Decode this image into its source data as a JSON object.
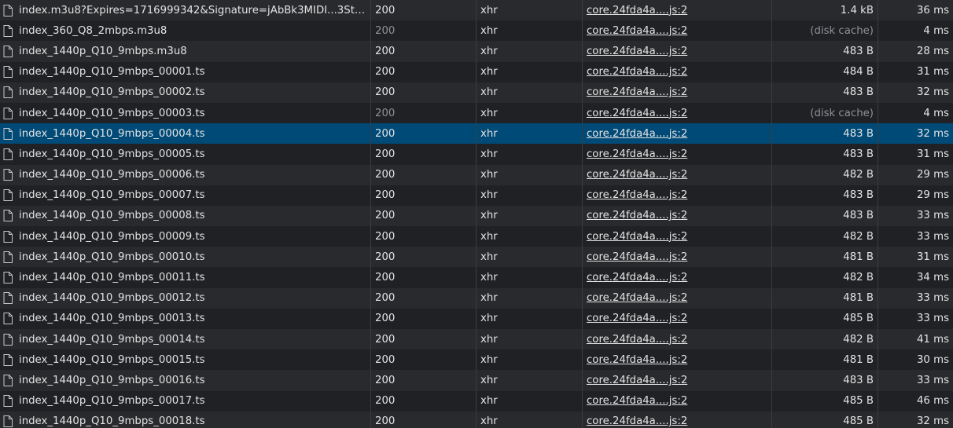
{
  "requests": [
    {
      "name": "index.m3u8?Expires=1716999342&Signature=jAbBk3MIDI...3StG...",
      "status": "200",
      "type": "xhr",
      "initiator": "core.24fda4a....js:2",
      "size": "1.4 kB",
      "time": "36 ms",
      "cached": false,
      "selected": false
    },
    {
      "name": "index_360_Q8_2mbps.m3u8",
      "status": "200",
      "type": "xhr",
      "initiator": "core.24fda4a....js:2",
      "size": "(disk cache)",
      "time": "4 ms",
      "cached": true,
      "selected": false
    },
    {
      "name": "index_1440p_Q10_9mbps.m3u8",
      "status": "200",
      "type": "xhr",
      "initiator": "core.24fda4a....js:2",
      "size": "483 B",
      "time": "28 ms",
      "cached": false,
      "selected": false
    },
    {
      "name": "index_1440p_Q10_9mbps_00001.ts",
      "status": "200",
      "type": "xhr",
      "initiator": "core.24fda4a....js:2",
      "size": "484 B",
      "time": "31 ms",
      "cached": false,
      "selected": false
    },
    {
      "name": "index_1440p_Q10_9mbps_00002.ts",
      "status": "200",
      "type": "xhr",
      "initiator": "core.24fda4a....js:2",
      "size": "483 B",
      "time": "32 ms",
      "cached": false,
      "selected": false
    },
    {
      "name": "index_1440p_Q10_9mbps_00003.ts",
      "status": "200",
      "type": "xhr",
      "initiator": "core.24fda4a....js:2",
      "size": "(disk cache)",
      "time": "4 ms",
      "cached": true,
      "selected": false
    },
    {
      "name": "index_1440p_Q10_9mbps_00004.ts",
      "status": "200",
      "type": "xhr",
      "initiator": "core.24fda4a....js:2",
      "size": "483 B",
      "time": "32 ms",
      "cached": false,
      "selected": true
    },
    {
      "name": "index_1440p_Q10_9mbps_00005.ts",
      "status": "200",
      "type": "xhr",
      "initiator": "core.24fda4a....js:2",
      "size": "483 B",
      "time": "31 ms",
      "cached": false,
      "selected": false
    },
    {
      "name": "index_1440p_Q10_9mbps_00006.ts",
      "status": "200",
      "type": "xhr",
      "initiator": "core.24fda4a....js:2",
      "size": "482 B",
      "time": "29 ms",
      "cached": false,
      "selected": false
    },
    {
      "name": "index_1440p_Q10_9mbps_00007.ts",
      "status": "200",
      "type": "xhr",
      "initiator": "core.24fda4a....js:2",
      "size": "483 B",
      "time": "29 ms",
      "cached": false,
      "selected": false
    },
    {
      "name": "index_1440p_Q10_9mbps_00008.ts",
      "status": "200",
      "type": "xhr",
      "initiator": "core.24fda4a....js:2",
      "size": "483 B",
      "time": "33 ms",
      "cached": false,
      "selected": false
    },
    {
      "name": "index_1440p_Q10_9mbps_00009.ts",
      "status": "200",
      "type": "xhr",
      "initiator": "core.24fda4a....js:2",
      "size": "482 B",
      "time": "33 ms",
      "cached": false,
      "selected": false
    },
    {
      "name": "index_1440p_Q10_9mbps_00010.ts",
      "status": "200",
      "type": "xhr",
      "initiator": "core.24fda4a....js:2",
      "size": "481 B",
      "time": "31 ms",
      "cached": false,
      "selected": false
    },
    {
      "name": "index_1440p_Q10_9mbps_00011.ts",
      "status": "200",
      "type": "xhr",
      "initiator": "core.24fda4a....js:2",
      "size": "482 B",
      "time": "34 ms",
      "cached": false,
      "selected": false
    },
    {
      "name": "index_1440p_Q10_9mbps_00012.ts",
      "status": "200",
      "type": "xhr",
      "initiator": "core.24fda4a....js:2",
      "size": "481 B",
      "time": "33 ms",
      "cached": false,
      "selected": false
    },
    {
      "name": "index_1440p_Q10_9mbps_00013.ts",
      "status": "200",
      "type": "xhr",
      "initiator": "core.24fda4a....js:2",
      "size": "485 B",
      "time": "33 ms",
      "cached": false,
      "selected": false
    },
    {
      "name": "index_1440p_Q10_9mbps_00014.ts",
      "status": "200",
      "type": "xhr",
      "initiator": "core.24fda4a....js:2",
      "size": "482 B",
      "time": "41 ms",
      "cached": false,
      "selected": false
    },
    {
      "name": "index_1440p_Q10_9mbps_00015.ts",
      "status": "200",
      "type": "xhr",
      "initiator": "core.24fda4a....js:2",
      "size": "481 B",
      "time": "30 ms",
      "cached": false,
      "selected": false
    },
    {
      "name": "index_1440p_Q10_9mbps_00016.ts",
      "status": "200",
      "type": "xhr",
      "initiator": "core.24fda4a....js:2",
      "size": "483 B",
      "time": "33 ms",
      "cached": false,
      "selected": false
    },
    {
      "name": "index_1440p_Q10_9mbps_00017.ts",
      "status": "200",
      "type": "xhr",
      "initiator": "core.24fda4a....js:2",
      "size": "485 B",
      "time": "46 ms",
      "cached": false,
      "selected": false
    },
    {
      "name": "index_1440p_Q10_9mbps_00018.ts",
      "status": "200",
      "type": "xhr",
      "initiator": "core.24fda4a....js:2",
      "size": "485 B",
      "time": "32 ms",
      "cached": false,
      "selected": false
    }
  ],
  "colors": {
    "background": "#202124",
    "row_alt": "#292a2d",
    "selected_row": "#004a77",
    "text": "#e3e3e3",
    "muted_text": "#8e9196"
  },
  "icons": {
    "file": "document-icon"
  }
}
